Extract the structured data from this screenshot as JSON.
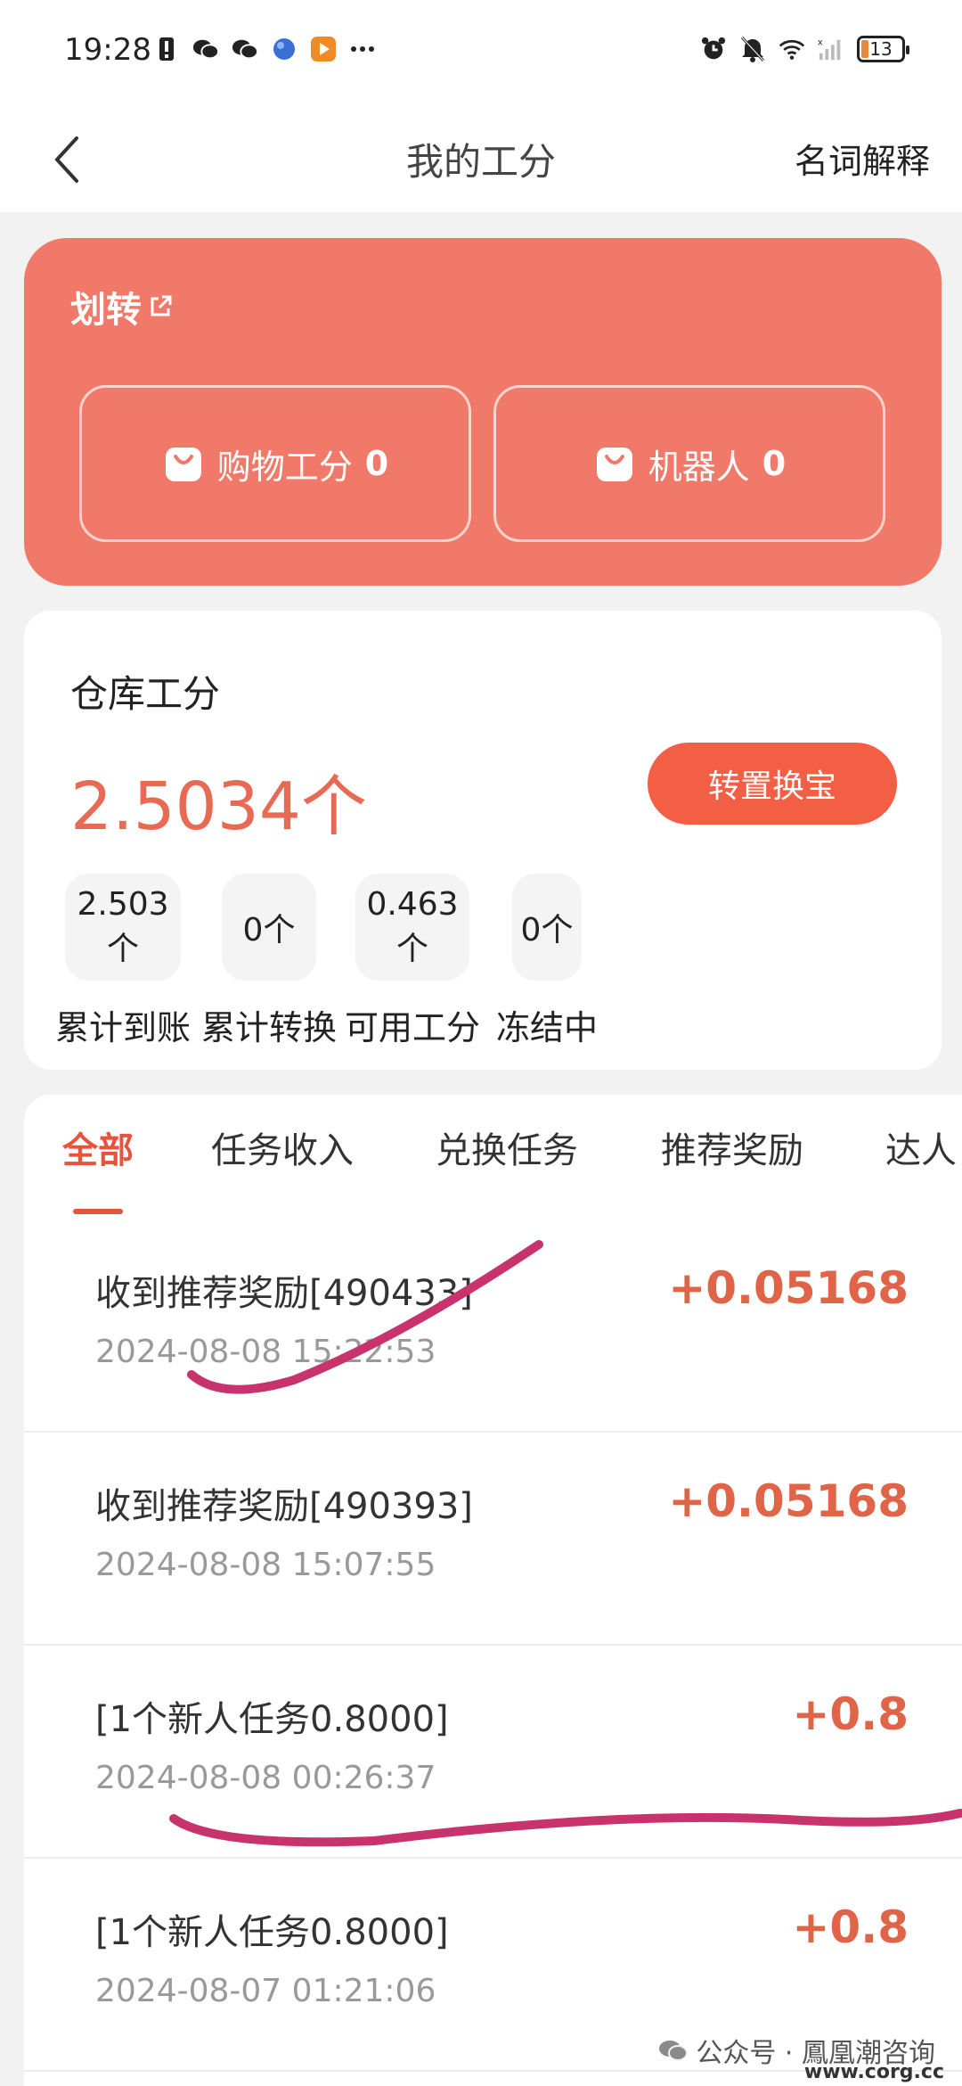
{
  "status_bar": {
    "time": "19:28",
    "battery": "13"
  },
  "nav": {
    "title": "我的工分",
    "right_link": "名词解释"
  },
  "transfer": {
    "title": "划转",
    "boxes": [
      {
        "label": "购物工分",
        "value": "0"
      },
      {
        "label": "机器人",
        "value": "0"
      }
    ]
  },
  "warehouse": {
    "title": "仓库工分",
    "amount": "2.5034个",
    "button": "转置换宝",
    "stats": [
      {
        "value": "2.503个",
        "label": "累计到账"
      },
      {
        "value": "0个",
        "label": "累计转换"
      },
      {
        "value": "0.463个",
        "label": "可用工分"
      },
      {
        "value": "0个",
        "label": "冻结中"
      }
    ]
  },
  "tabs": [
    "全部",
    "任务收入",
    "兑换任务",
    "推荐奖励",
    "达人"
  ],
  "records": [
    {
      "title": "收到推荐奖励[490433]",
      "time": "2024-08-08 15:22:53",
      "amount": "+0.05168"
    },
    {
      "title": "收到推荐奖励[490393]",
      "time": "2024-08-08 15:07:55",
      "amount": "+0.05168"
    },
    {
      "title": "[1个新人任务0.8000]",
      "time": "2024-08-08 00:26:37",
      "amount": "+0.8"
    },
    {
      "title": "[1个新人任务0.8000]",
      "time": "2024-08-07 01:21:06",
      "amount": "+0.8"
    }
  ],
  "watermark": {
    "text": "公众号 · 鳳凰潮咨询",
    "site": "www.corg.cc"
  },
  "colors": {
    "accent": "#f1796a",
    "button": "#f35f45",
    "amount": "#e06447",
    "marker": "#c8336e"
  }
}
